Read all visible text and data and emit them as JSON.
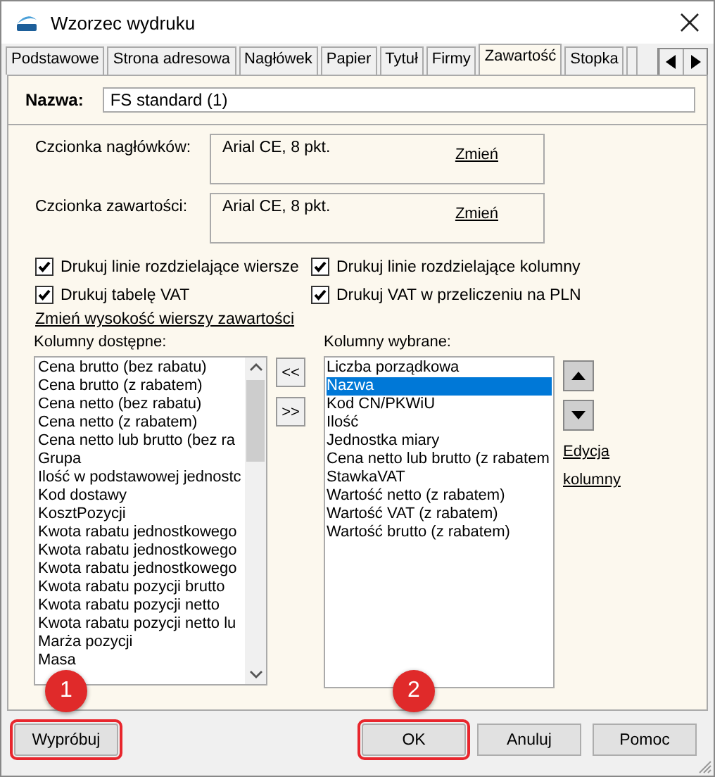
{
  "window": {
    "title": "Wzorzec wydruku"
  },
  "tabs": [
    {
      "label": "Podstawowe",
      "selected": false
    },
    {
      "label": "Strona adresowa",
      "selected": false
    },
    {
      "label": "Nagłówek",
      "selected": false
    },
    {
      "label": "Papier",
      "selected": false
    },
    {
      "label": "Tytuł",
      "selected": false
    },
    {
      "label": "Firmy",
      "selected": false
    },
    {
      "label": "Zawartość",
      "selected": true
    },
    {
      "label": "Stopka",
      "selected": false
    }
  ],
  "name_field": {
    "label": "Nazwa:",
    "value": "FS standard (1)"
  },
  "fonts": [
    {
      "label": "Czcionka nagłówków:",
      "value": "Arial CE, 8 pkt.",
      "link": "Zmień"
    },
    {
      "label": "Czcionka zawartości:",
      "value": "Arial CE, 8 pkt.",
      "link": "Zmień"
    }
  ],
  "options": [
    {
      "label": "Drukuj linie rozdzielające wiersze",
      "checked": true
    },
    {
      "label": "Drukuj linie rozdzielające kolumny",
      "checked": true
    },
    {
      "label": "Drukuj tabelę VAT",
      "checked": true
    },
    {
      "label": "Drukuj VAT w przeliczeniu na PLN",
      "checked": true
    }
  ],
  "row_height_link": "Zmień wysokość wierszy zawartości",
  "available": {
    "label": "Kolumny dostępne:",
    "items": [
      "Cena brutto (bez rabatu)",
      "Cena brutto (z rabatem)",
      "Cena netto (bez rabatu)",
      "Cena netto (z rabatem)",
      "Cena netto lub brutto (bez ra",
      "Grupa",
      "Ilość w podstawowej jednostc",
      "Kod dostawy",
      "KosztPozycji",
      "Kwota rabatu jednostkowego",
      "Kwota rabatu jednostkowego",
      "Kwota rabatu jednostkowego",
      "Kwota rabatu pozycji brutto",
      "Kwota rabatu pozycji netto",
      "Kwota rabatu pozycji netto lu",
      "Marża pozycji",
      "Masa"
    ]
  },
  "transfer_buttons": [
    "<<",
    ">>"
  ],
  "chosen": {
    "label": "Kolumny wybrane:",
    "items": [
      {
        "text": "Liczba porządkowa",
        "selected": false
      },
      {
        "text": "Nazwa",
        "selected": true
      },
      {
        "text": "Kod CN/PKWiU",
        "selected": false
      },
      {
        "text": "Ilość",
        "selected": false
      },
      {
        "text": "Jednostka miary",
        "selected": false
      },
      {
        "text": "Cena netto lub brutto (z rabatem",
        "selected": false
      },
      {
        "text": "StawkaVAT",
        "selected": false
      },
      {
        "text": "Wartość netto (z rabatem)",
        "selected": false
      },
      {
        "text": "Wartość VAT (z rabatem)",
        "selected": false
      },
      {
        "text": "Wartość brutto (z rabatem)",
        "selected": false
      }
    ]
  },
  "edit_link": [
    "Edycja",
    "kolumny"
  ],
  "buttons": [
    {
      "label": "Wypróbuj",
      "highlighted": true,
      "badge": "1"
    },
    {
      "label": "OK",
      "highlighted": true,
      "badge": "2"
    },
    {
      "label": "Anuluj",
      "highlighted": false
    },
    {
      "label": "Pomoc",
      "highlighted": false
    }
  ]
}
